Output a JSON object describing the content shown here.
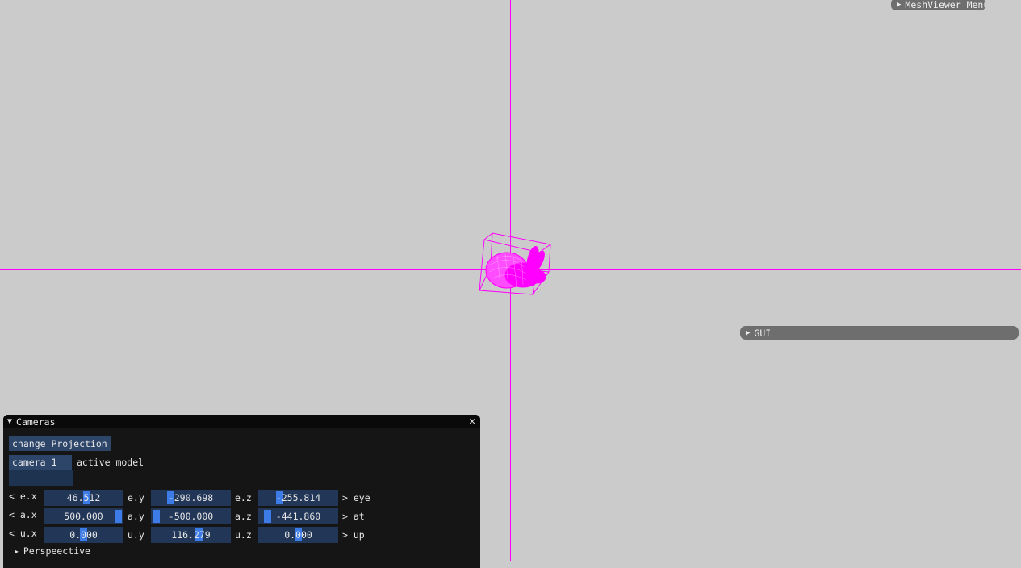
{
  "colors": {
    "background": "#cbcbcb",
    "axis": "#ff00ff",
    "mesh": "#ff00ff",
    "panel_bg": "#151515",
    "field_bg": "#223757",
    "button_bg": "#2c4568",
    "slider_grab": "#3d7be6"
  },
  "meshviewer_menu": {
    "title": "MeshViewer Menu",
    "icon": "triangle-right-icon"
  },
  "gui_window": {
    "title": "GUI",
    "icon": "triangle-right-icon"
  },
  "cameras": {
    "title": "Cameras",
    "collapse_icon": "triangle-down-icon",
    "close_icon": "close-icon",
    "change_projection_label": "change Projection",
    "camera_combo_value": "camera 1",
    "active_model_label": "active model",
    "eye": {
      "left_label": "< e.x",
      "x": "46.512",
      "y_label": "e.y",
      "y": "-290.698",
      "z_label": "e.z",
      "z": "-255.814",
      "right_label": "> eye"
    },
    "at": {
      "left_label": "< a.x",
      "x": "500.000",
      "y_label": "a.y",
      "y": "-500.000",
      "z_label": "a.z",
      "z": "-441.860",
      "right_label": "> at"
    },
    "up": {
      "left_label": "< u.x",
      "x": "0.000",
      "y_label": "u.y",
      "y": "116.279",
      "z_label": "u.z",
      "z": "0.000",
      "right_label": "> up"
    },
    "perspective_label": "Perspeective"
  }
}
